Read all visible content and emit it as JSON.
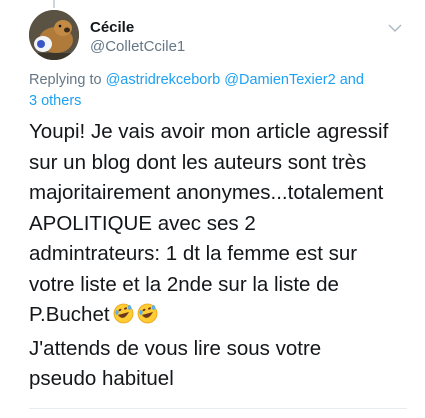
{
  "author": {
    "display_name": "Cécile",
    "handle": "@ColletCcile1",
    "avatar_icon": "dog-photo-avatar"
  },
  "reply_context": {
    "prefix": "Replying to",
    "mentions": [
      "@astridrekceborb",
      "@DamienTexier2"
    ],
    "and": "and",
    "others": "3 others"
  },
  "tweet": {
    "lines": [
      "Youpi! Je vais avoir mon article agressif",
      "sur un blog dont les auteurs sont très",
      "majoritairement anonymes...totalement",
      "APOLITIQUE avec ses 2",
      "admintrateurs: 1 dt la femme est sur",
      "votre liste et la 2nde sur la liste de",
      "P.Buchet",
      "J'attends de vous lire sous votre",
      "pseudo habituel"
    ],
    "emoji_after_line_7": [
      "rolling-on-floor-laughing-emoji",
      "rolling-on-floor-laughing-emoji"
    ]
  },
  "colors": {
    "link": "#1da1f2",
    "secondary_text": "#657786",
    "primary_text": "#14171a",
    "divider": "#e6ecf0"
  },
  "menu_icon": "chevron-down-icon"
}
